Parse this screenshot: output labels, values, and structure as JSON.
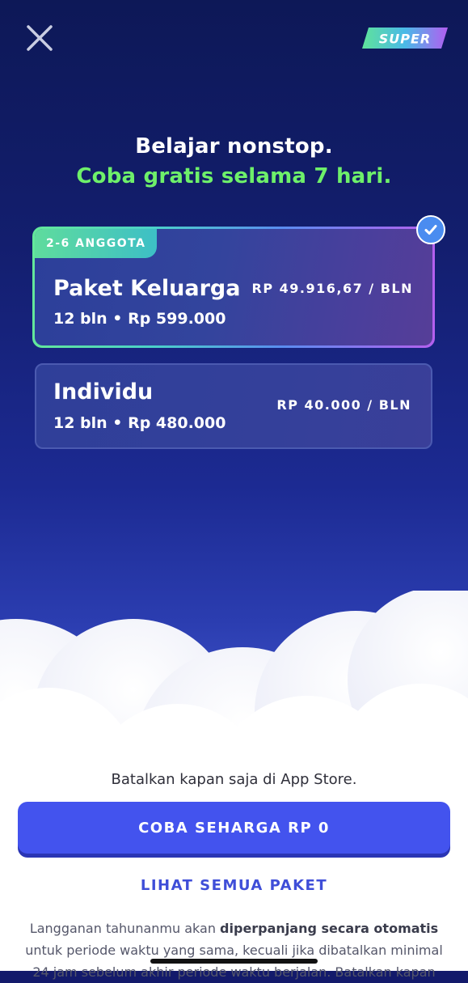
{
  "header": {
    "close_icon": "close-icon",
    "badge_label": "SUPER"
  },
  "headline": {
    "line1": "Belajar nonstop.",
    "line2": "Coba gratis selama 7 hari."
  },
  "plans": [
    {
      "tag": "2-6 ANGGOTA",
      "name": "Paket Keluarga",
      "term": "12 bln • Rp 599.000",
      "price": "RP 49.916,67 / BLN",
      "selected": true
    },
    {
      "name": "Individu",
      "term": "12 bln • Rp 480.000",
      "price": "RP 40.000 / BLN",
      "selected": false
    }
  ],
  "footer": {
    "cancel_note": "Batalkan kapan saja di App Store.",
    "cta_label": "COBA SEHARGA RP 0",
    "see_all_label": "LIHAT SEMUA PAKET",
    "legal_part1": "Langganan tahunanmu akan ",
    "legal_bold": "diperpanjang secara otomatis",
    "legal_part2": " untuk periode waktu yang sama, kecuali jika dibatalkan minimal 24 jam sebelum akhir periode waktu berjalan. Batalkan kapan"
  },
  "colors": {
    "accent_green": "#6ef06a",
    "cta_blue": "#4353ee",
    "link_blue": "#3f4ed8",
    "check_blue": "#4a8cf0"
  }
}
